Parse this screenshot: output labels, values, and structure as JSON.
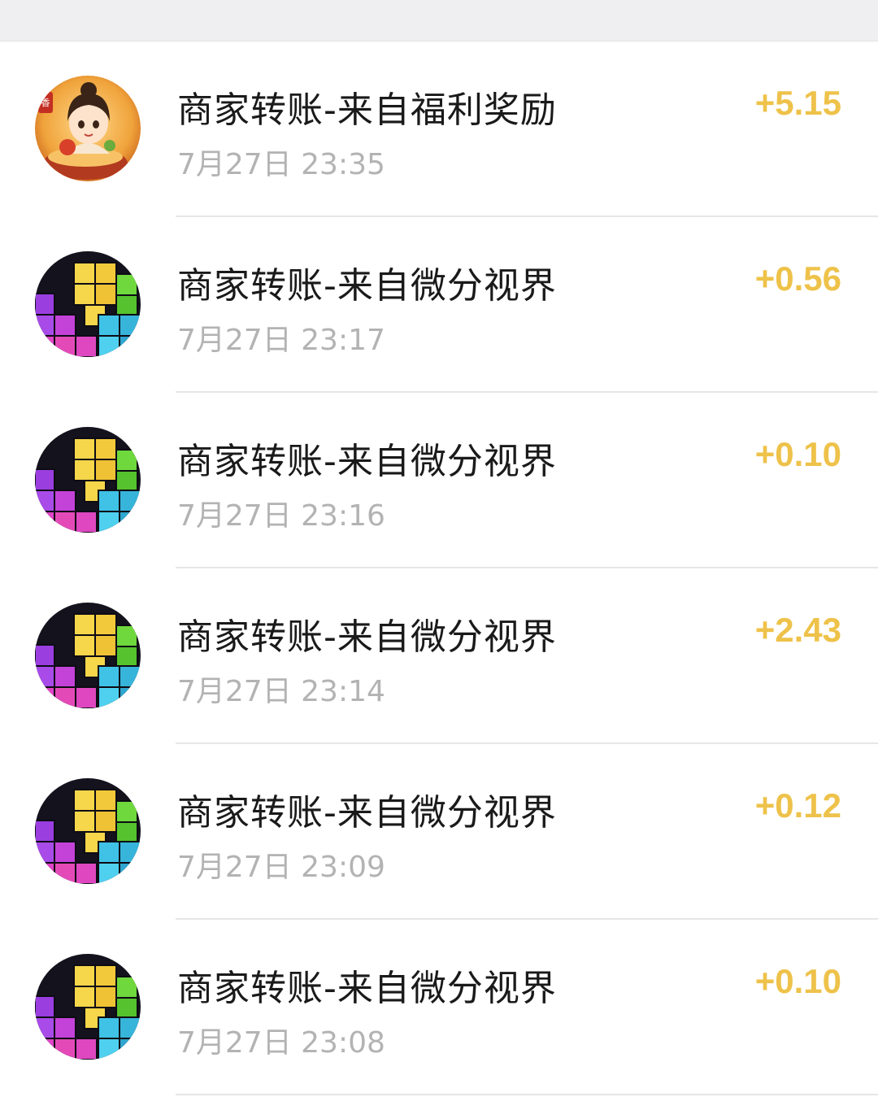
{
  "colors": {
    "amount": "#eec24a",
    "title": "#1a1a1a",
    "time": "#b3b3b3",
    "divider": "#e6e6e8",
    "top_strip": "#efeff1"
  },
  "transactions": [
    {
      "title": "商家转账-来自福利奖励",
      "time": "7月27日 23:35",
      "amount": "+5.15",
      "avatar": "character-avatar-icon"
    },
    {
      "title": "商家转账-来自微分视界",
      "time": "7月27日 23:17",
      "amount": "+0.56",
      "avatar": "block-puzzle-avatar-icon"
    },
    {
      "title": "商家转账-来自微分视界",
      "time": "7月27日 23:16",
      "amount": "+0.10",
      "avatar": "block-puzzle-avatar-icon"
    },
    {
      "title": "商家转账-来自微分视界",
      "time": "7月27日 23:14",
      "amount": "+2.43",
      "avatar": "block-puzzle-avatar-icon"
    },
    {
      "title": "商家转账-来自微分视界",
      "time": "7月27日 23:09",
      "amount": "+0.12",
      "avatar": "block-puzzle-avatar-icon"
    },
    {
      "title": "商家转账-来自微分视界",
      "time": "7月27日 23:08",
      "amount": "+0.10",
      "avatar": "block-puzzle-avatar-icon"
    }
  ]
}
